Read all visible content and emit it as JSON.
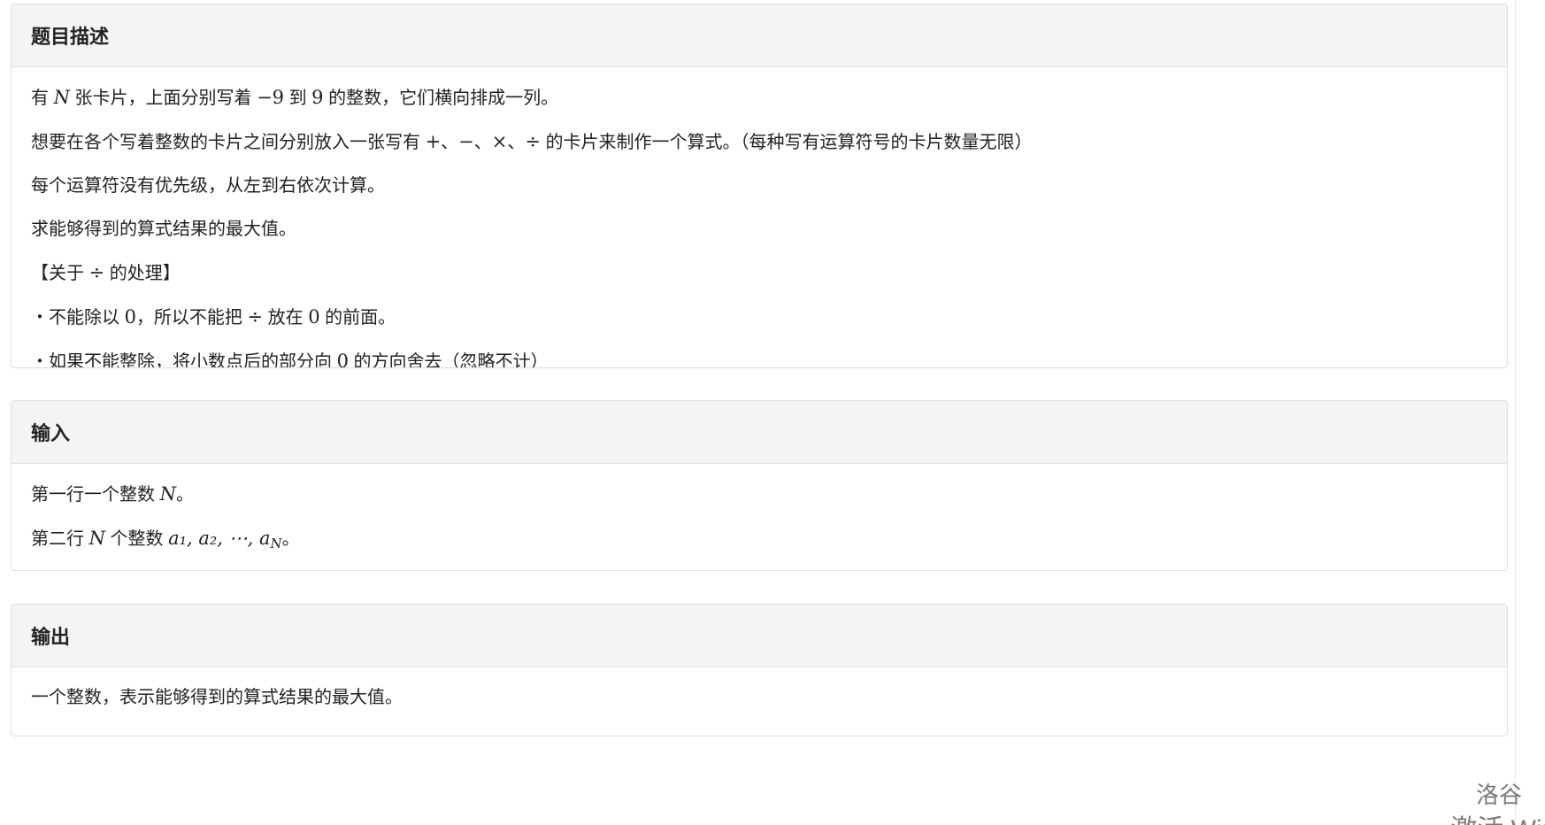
{
  "sections": [
    {
      "title": "题目描述",
      "paragraphs": [
        [
          {
            "t": "有 "
          },
          {
            "m": "N",
            "i": true
          },
          {
            "t": " 张卡片，上面分别写着 "
          },
          {
            "m": "−9"
          },
          {
            "t": " 到 "
          },
          {
            "m": "9"
          },
          {
            "t": " 的整数，它们横向排成一列。"
          }
        ],
        [
          {
            "t": "想要在各个写着整数的卡片之间分别放入一张写有 "
          },
          {
            "m": "+"
          },
          {
            "t": "、"
          },
          {
            "m": "−"
          },
          {
            "t": "、"
          },
          {
            "m": "×"
          },
          {
            "t": "、"
          },
          {
            "m": "÷"
          },
          {
            "t": " 的卡片来制作一个算式。（每种写有运算符号的卡片数量无限）"
          }
        ],
        [
          {
            "t": "每个运算符没有优先级，从左到右依次计算。"
          }
        ],
        [
          {
            "t": "求能够得到的算式结果的最大值。"
          }
        ],
        [
          {
            "t": "【关于 "
          },
          {
            "m": "÷"
          },
          {
            "t": " 的处理】"
          }
        ],
        [
          {
            "t": "・不能除以 "
          },
          {
            "m": "0"
          },
          {
            "t": "，所以不能把 "
          },
          {
            "m": "÷"
          },
          {
            "t": " 放在 "
          },
          {
            "m": "0"
          },
          {
            "t": " 的前面。"
          }
        ],
        [
          {
            "t": "・如果不能整除，将小数点后的部分向 "
          },
          {
            "m": "0"
          },
          {
            "t": " 的方向舍去（忽略不计）"
          }
        ]
      ]
    },
    {
      "title": "输入",
      "paragraphs": [
        [
          {
            "t": "第一行一个整数 "
          },
          {
            "m": "N",
            "i": true
          },
          {
            "t": "。"
          }
        ],
        [
          {
            "t": "第二行 "
          },
          {
            "m": "N",
            "i": true
          },
          {
            "t": " 个整数 "
          },
          {
            "m": "a₁, a₂, ⋯, a",
            "i": true
          },
          {
            "m": "N",
            "i": true,
            "sub": true
          },
          {
            "t": "。"
          }
        ]
      ]
    },
    {
      "title": "输出",
      "paragraphs": [
        [
          {
            "t": "一个整数，表示能够得到的算式结果的最大值。"
          }
        ]
      ]
    }
  ],
  "watermark": {
    "line1": "洛谷",
    "line2": "激活 Wind"
  }
}
